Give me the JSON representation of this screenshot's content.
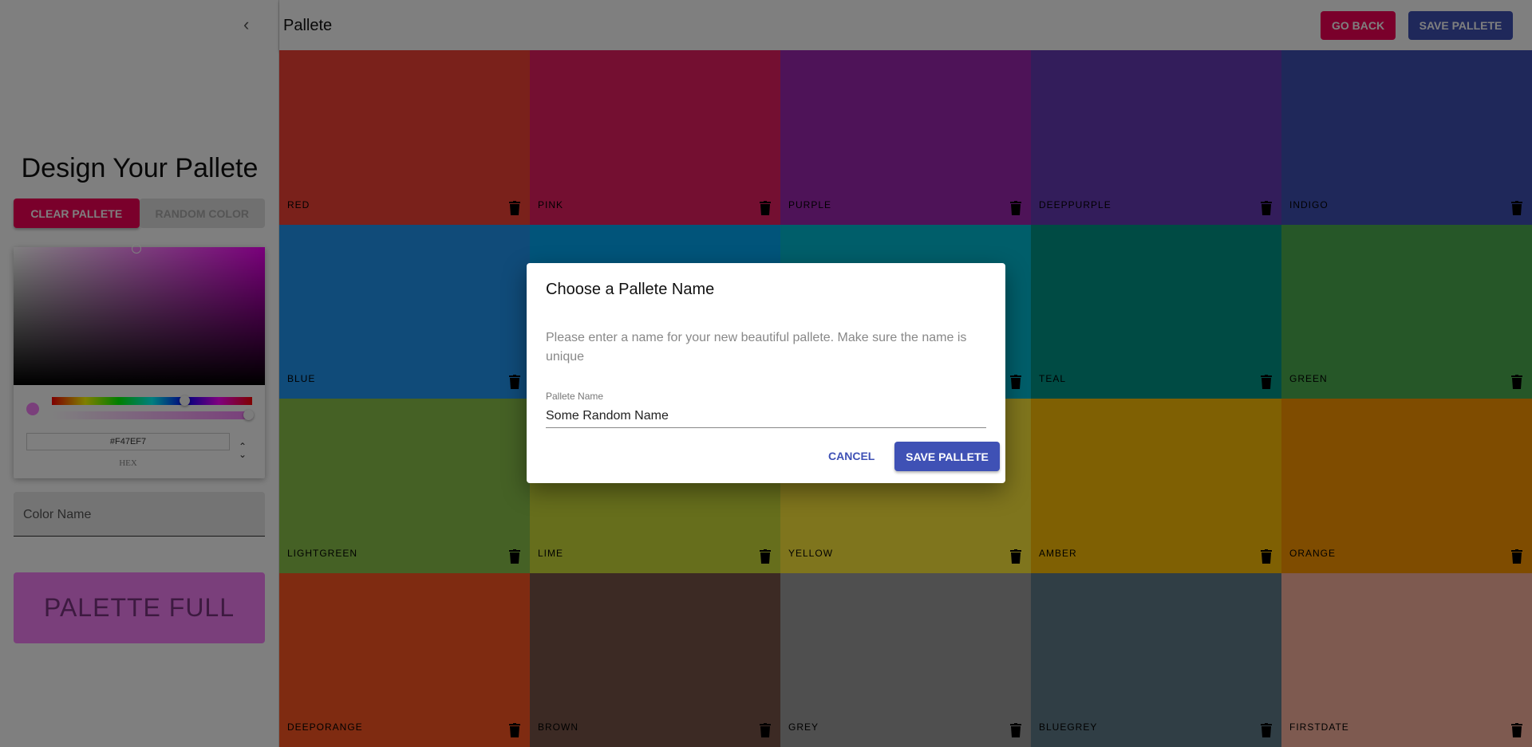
{
  "sidebar": {
    "title": "Design Your Pallete",
    "clear_label": "CLEAR PALLETE",
    "random_label": "RANDOM COLOR",
    "hex_value": "#F47EF7",
    "hex_format": "HEX",
    "color_name_placeholder": "Color Name",
    "palette_full_label": "PALETTE FULL",
    "current_color": "#F47EF7"
  },
  "header": {
    "title": "Pallete",
    "go_back_label": "GO BACK",
    "save_label": "SAVE PALLETE"
  },
  "palette": [
    {
      "name": "RED",
      "color": "#F44336"
    },
    {
      "name": "PINK",
      "color": "#E91E63"
    },
    {
      "name": "PURPLE",
      "color": "#9C27B0"
    },
    {
      "name": "DEEPPURPLE",
      "color": "#673AB7"
    },
    {
      "name": "INDIGO",
      "color": "#3F51B5"
    },
    {
      "name": "BLUE",
      "color": "#2196F3"
    },
    {
      "name": "",
      "color": "#03A9F4"
    },
    {
      "name": "",
      "color": "#00BCD4"
    },
    {
      "name": "TEAL",
      "color": "#009688"
    },
    {
      "name": "GREEN",
      "color": "#4CAF50"
    },
    {
      "name": "LIGHTGREEN",
      "color": "#8BC34A"
    },
    {
      "name": "LIME",
      "color": "#CDDC39"
    },
    {
      "name": "YELLOW",
      "color": "#FFEB3B"
    },
    {
      "name": "AMBER",
      "color": "#FFC107"
    },
    {
      "name": "ORANGE",
      "color": "#FF9800"
    },
    {
      "name": "DEEPORANGE",
      "color": "#FF5722"
    },
    {
      "name": "BROWN",
      "color": "#795548"
    },
    {
      "name": "GREY",
      "color": "#9E9E9E"
    },
    {
      "name": "BLUEGREY",
      "color": "#607D8B"
    },
    {
      "name": "FIRSTDATE",
      "color": "#FCB4A0"
    }
  ],
  "dialog": {
    "title": "Choose a Pallete Name",
    "text": "Please enter a name for your new beautiful pallete. Make sure the name is unique",
    "field_label": "Pallete Name",
    "field_value": "Some Random Name",
    "cancel_label": "CANCEL",
    "save_label": "SAVE PALLETE"
  }
}
